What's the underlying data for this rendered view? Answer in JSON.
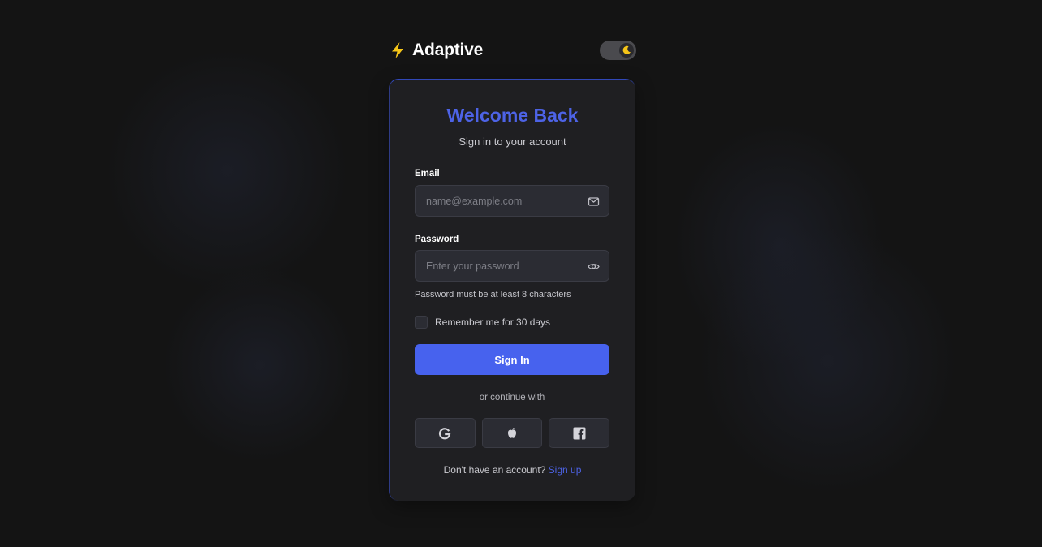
{
  "brand": {
    "name": "Adaptive",
    "icon": "lightning-bolt-icon",
    "icon_color": "#f5c518"
  },
  "theme_toggle": {
    "icon": "moon-icon",
    "mode": "dark"
  },
  "form": {
    "title": "Welcome Back",
    "subtitle": "Sign in to your account",
    "email": {
      "label": "Email",
      "placeholder": "name@example.com",
      "value": "",
      "icon": "mail-icon"
    },
    "password": {
      "label": "Password",
      "placeholder": "Enter your password",
      "value": "",
      "icon": "eye-icon"
    },
    "password_hint": "Password must be at least 8 characters",
    "remember": {
      "label": "Remember me for 30 days",
      "checked": false
    },
    "submit_label": "Sign In",
    "divider_text": "or continue with",
    "social": [
      {
        "name": "google",
        "icon": "google-icon"
      },
      {
        "name": "apple",
        "icon": "apple-icon"
      },
      {
        "name": "facebook",
        "icon": "facebook-icon"
      }
    ],
    "footer_text": "Don't have an account?",
    "footer_link": "Sign up"
  },
  "colors": {
    "accent": "#4762ee",
    "title": "#4d63e6",
    "background": "#141414",
    "card": "#1f1f22"
  }
}
